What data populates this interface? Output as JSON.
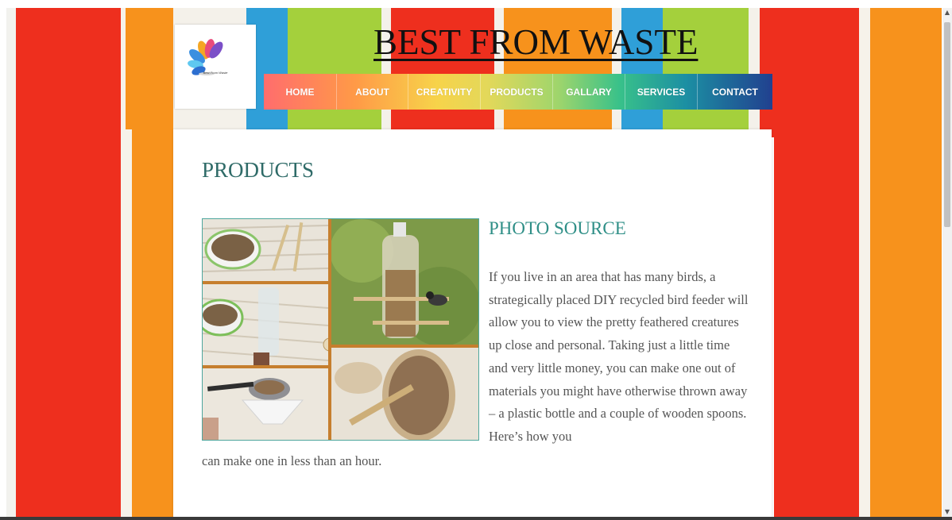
{
  "site": {
    "title": "BEST FROM WASTE",
    "logo_text": "Best From Waste"
  },
  "nav": {
    "items": [
      {
        "label": "HOME"
      },
      {
        "label": "ABOUT"
      },
      {
        "label": "CREATIVITY"
      },
      {
        "label": "PRODUCTS"
      },
      {
        "label": "GALLARY"
      },
      {
        "label": "SERVICES"
      },
      {
        "label": "CONTACT"
      }
    ]
  },
  "content": {
    "page_title": "PRODUCTS",
    "section_heading": "PHOTO SOURCE",
    "body_main": "If you live in an area that has many birds, a strategically placed DIY recycled bird feeder will allow you to view the pretty feathered creatures up close and personal. Taking just a little time and very little money, you can make one out of materials you might have otherwise thrown away – a plastic bottle and a couple of wooden spoons. Here’s how you",
    "body_continued": "can make one in less than an hour."
  },
  "colors": {
    "stripe_red": "#ee2f1e",
    "stripe_orange": "#f7921c",
    "stripe_blue": "#2f9fd8",
    "stripe_green": "#a4d03c",
    "heading_teal": "#2f8f87"
  }
}
